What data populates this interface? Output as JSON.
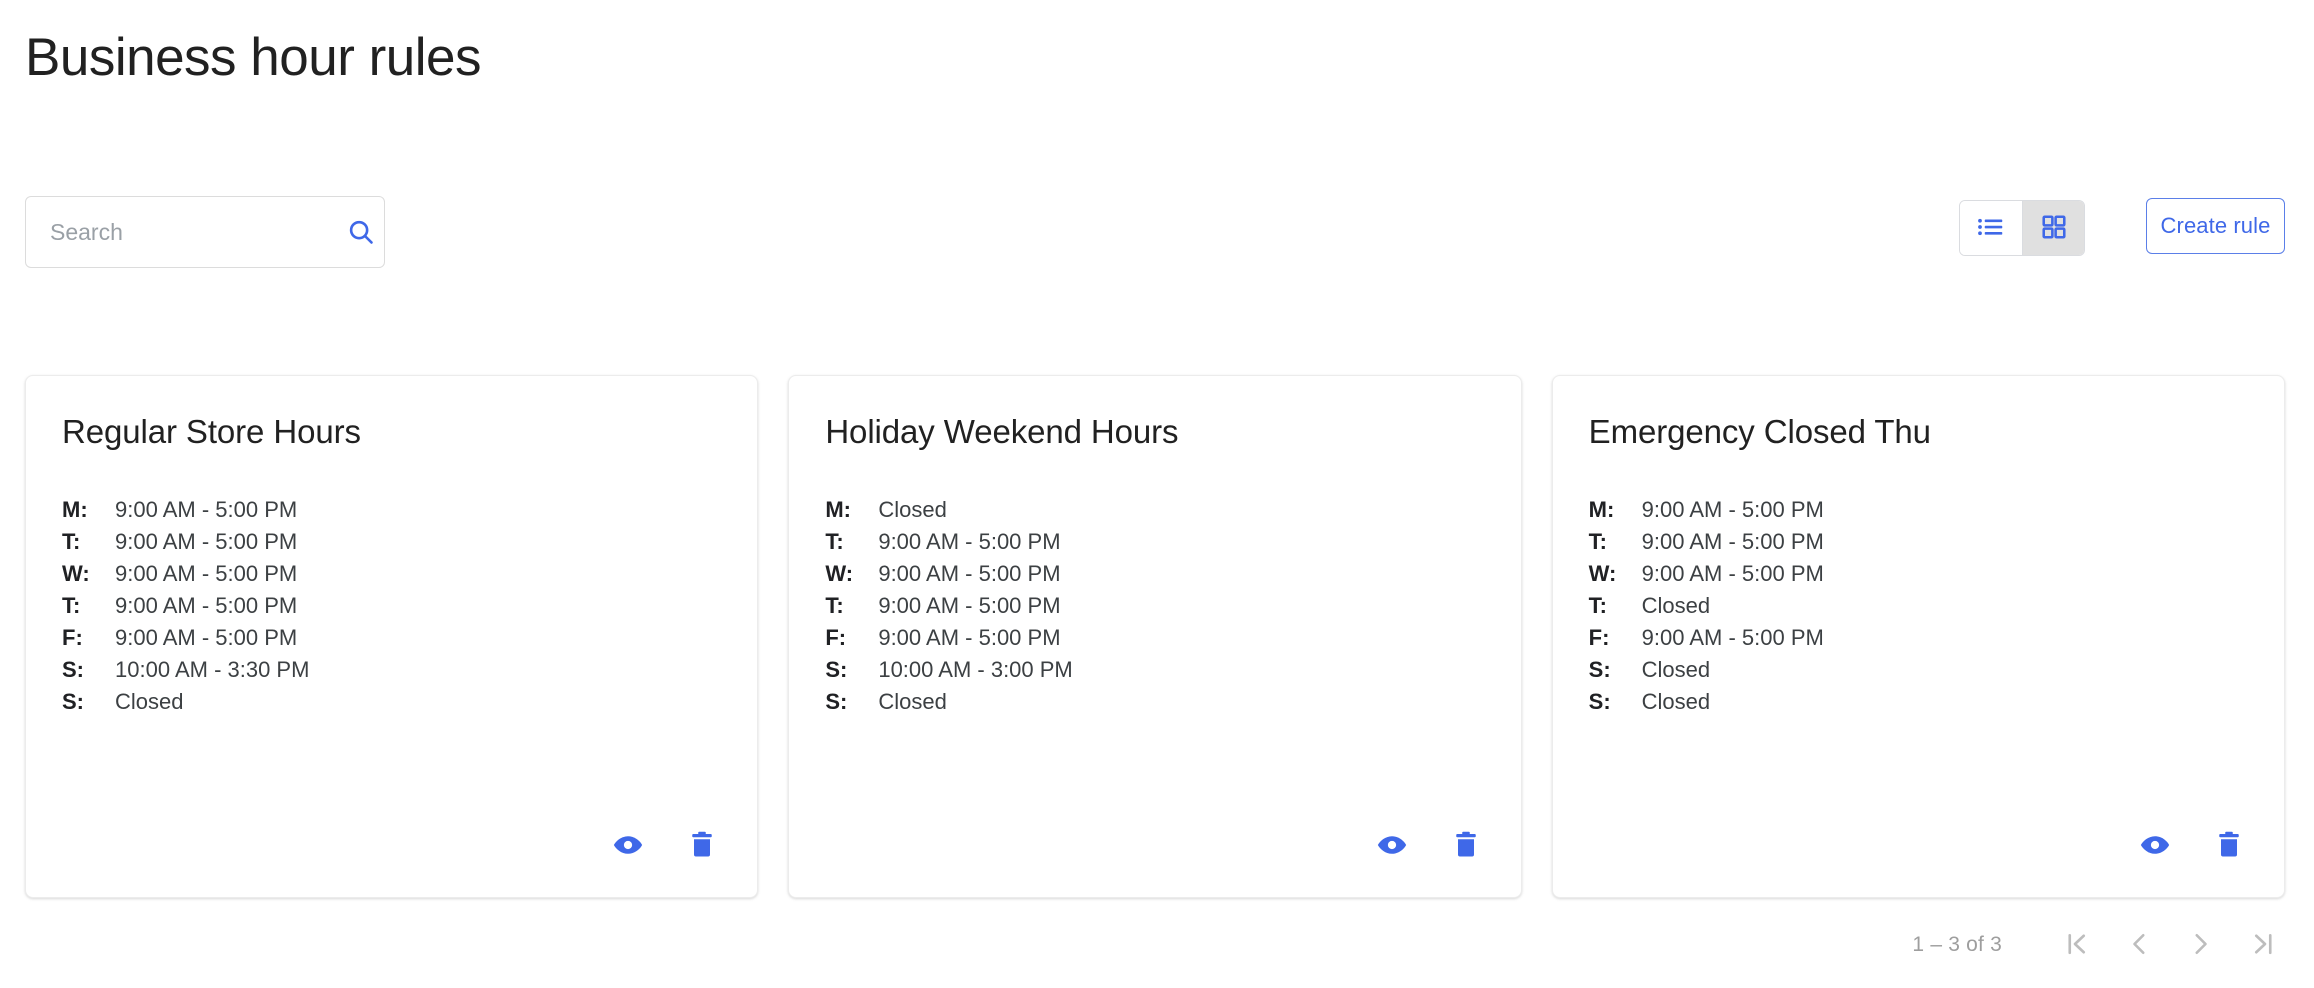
{
  "page": {
    "title": "Business hour rules"
  },
  "search": {
    "placeholder": "Search",
    "value": "",
    "icon": "search-icon"
  },
  "view_toggle": {
    "options": [
      {
        "id": "list",
        "icon": "list-view-icon",
        "selected": false
      },
      {
        "id": "grid",
        "icon": "grid-view-icon",
        "selected": true
      }
    ]
  },
  "actions": {
    "create_rule_label": "Create rule"
  },
  "colors": {
    "accent_blue": "#3f68e8",
    "icon_blue": "#3f68e8",
    "selected_toggle_bg": "#e0e0e0",
    "muted_text": "#9e9e9e",
    "border": "#dadce0"
  },
  "cards": [
    {
      "title": "Regular Store Hours",
      "hours": [
        {
          "day": "M:",
          "value": "9:00 AM - 5:00 PM"
        },
        {
          "day": "T:",
          "value": "9:00 AM - 5:00 PM"
        },
        {
          "day": "W:",
          "value": "9:00 AM - 5:00 PM"
        },
        {
          "day": "T:",
          "value": "9:00 AM - 5:00 PM"
        },
        {
          "day": "F:",
          "value": "9:00 AM - 5:00 PM"
        },
        {
          "day": "S:",
          "value": "10:00 AM - 3:30 PM"
        },
        {
          "day": "S:",
          "value": "Closed"
        }
      ],
      "actions": [
        {
          "id": "view",
          "icon": "eye-icon"
        },
        {
          "id": "delete",
          "icon": "trash-icon"
        }
      ]
    },
    {
      "title": "Holiday Weekend Hours",
      "hours": [
        {
          "day": "M:",
          "value": "Closed"
        },
        {
          "day": "T:",
          "value": "9:00 AM - 5:00 PM"
        },
        {
          "day": "W:",
          "value": "9:00 AM - 5:00 PM"
        },
        {
          "day": "T:",
          "value": "9:00 AM - 5:00 PM"
        },
        {
          "day": "F:",
          "value": "9:00 AM - 5:00 PM"
        },
        {
          "day": "S:",
          "value": "10:00 AM - 3:00 PM"
        },
        {
          "day": "S:",
          "value": "Closed"
        }
      ],
      "actions": [
        {
          "id": "view",
          "icon": "eye-icon"
        },
        {
          "id": "delete",
          "icon": "trash-icon"
        }
      ]
    },
    {
      "title": "Emergency Closed Thu",
      "hours": [
        {
          "day": "M:",
          "value": "9:00 AM - 5:00 PM"
        },
        {
          "day": "T:",
          "value": "9:00 AM - 5:00 PM"
        },
        {
          "day": "W:",
          "value": "9:00 AM - 5:00 PM"
        },
        {
          "day": "T:",
          "value": "Closed"
        },
        {
          "day": "F:",
          "value": "9:00 AM - 5:00 PM"
        },
        {
          "day": "S:",
          "value": "Closed"
        },
        {
          "day": "S:",
          "value": "Closed"
        }
      ],
      "actions": [
        {
          "id": "view",
          "icon": "eye-icon"
        },
        {
          "id": "delete",
          "icon": "trash-icon"
        }
      ]
    }
  ],
  "paginator": {
    "range_label": "1 – 3 of 3",
    "buttons": [
      {
        "id": "first",
        "icon": "first-page-icon"
      },
      {
        "id": "previous",
        "icon": "chevron-left-icon"
      },
      {
        "id": "next",
        "icon": "chevron-right-icon"
      },
      {
        "id": "last",
        "icon": "last-page-icon"
      }
    ]
  }
}
